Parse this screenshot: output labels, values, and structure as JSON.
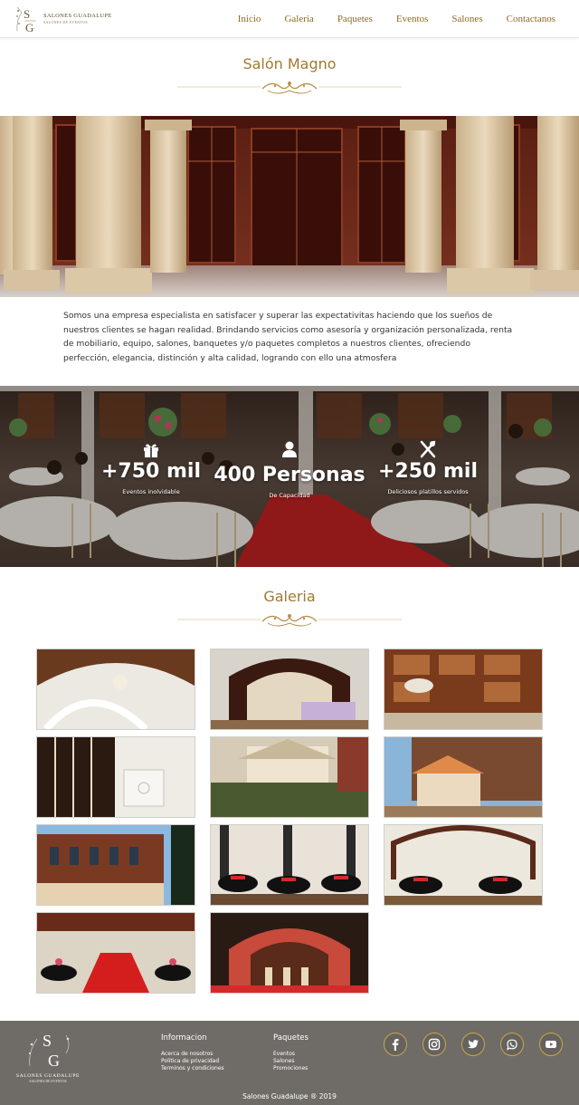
{
  "brand": {
    "logo_letters": "SG",
    "name": "SALONES GUADALUPE",
    "tagline": "SALONES DE EVENTOS",
    "accent_color": "#a07a2e"
  },
  "nav": {
    "items": [
      {
        "label": "Inicio"
      },
      {
        "label": "Galeria"
      },
      {
        "label": "Paquetes"
      },
      {
        "label": "Eventos"
      },
      {
        "label": "Salones"
      },
      {
        "label": "Contactanos"
      }
    ]
  },
  "salon": {
    "title": "Salón Magno",
    "description": "Somos una empresa especialista en satisfacer y superar las expectativitas haciendo que los  sueños de nuestros clientes se hagan  realidad. Brindando servicios como asesoría y organización personalizada, renta de mobiliario, equipo, salones, banquetes y/o  paquetes completos a nuestros clientes, ofreciendo perfección, elegancia, distinción y alta calidad, logrando  con ello  una  atmosfera"
  },
  "stats": [
    {
      "icon": "gift-icon",
      "value": "+750 mil",
      "label": "Eventos inolvidable"
    },
    {
      "icon": "user-icon",
      "value": "400 Personas",
      "label": "De Capacidad"
    },
    {
      "icon": "utensils-icon",
      "value": "+250 mil",
      "label": "Deliciosos platillos servidos"
    }
  ],
  "gallery": {
    "title": "Galeria",
    "count": 11
  },
  "footer": {
    "info": {
      "heading": "Informacion",
      "links": [
        "Acerca de nosotros",
        "Politica de privacidad",
        "Terminos y condiciones"
      ]
    },
    "packages": {
      "heading": "Paquetes",
      "links": [
        "Eventos",
        "Salones",
        "Promociones"
      ]
    },
    "socials": [
      "facebook-icon",
      "instagram-icon",
      "twitter-icon",
      "whatsapp-icon",
      "youtube-icon"
    ],
    "copyright": "Salones Guadalupe ® 2019"
  }
}
